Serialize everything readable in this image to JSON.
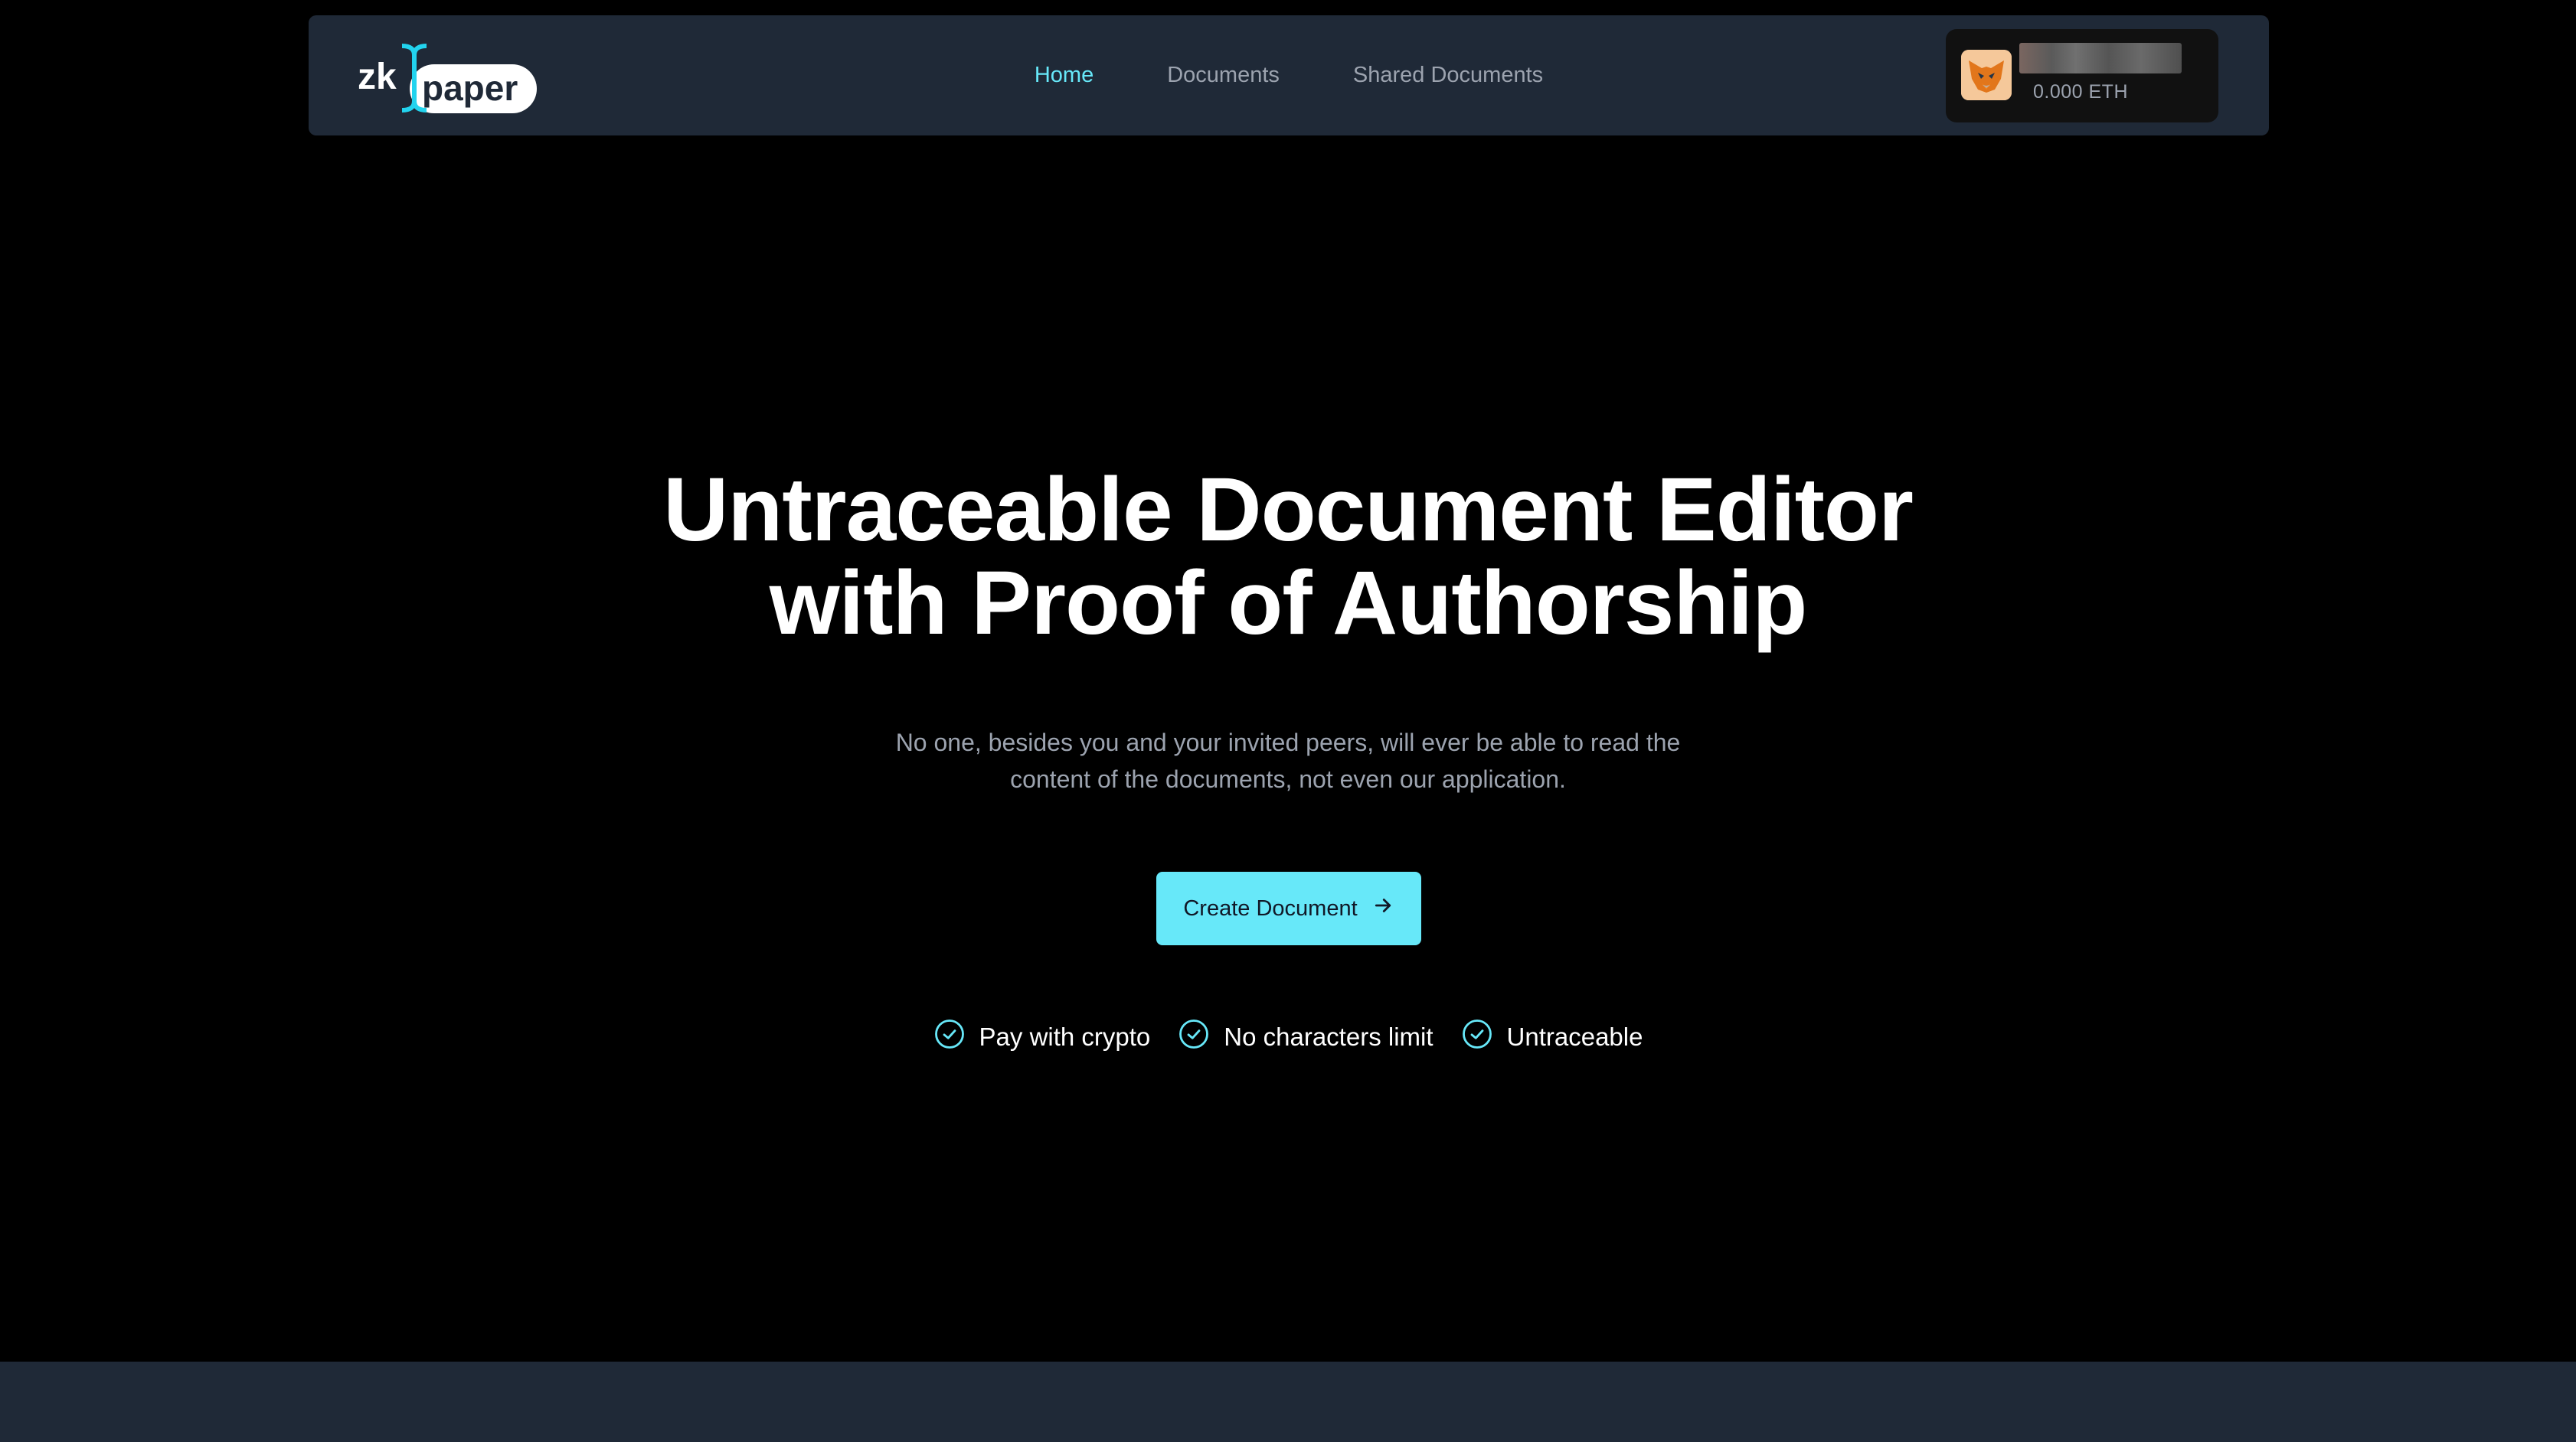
{
  "brand": {
    "logo_left": "zk",
    "logo_right": "paper"
  },
  "nav": {
    "items": [
      {
        "label": "Home",
        "active": true
      },
      {
        "label": "Documents",
        "active": false
      },
      {
        "label": "Shared Documents",
        "active": false
      }
    ]
  },
  "wallet": {
    "avatar_icon": "metamask-fox-icon",
    "balance": "0.000 ETH"
  },
  "hero": {
    "title_line1": "Untraceable Document Editor",
    "title_line2": "with Proof of Authorship",
    "subtitle_line1": "No one, besides you and your invited peers, will ever be able to read the",
    "subtitle_line2": "content of the documents, not even our application.",
    "cta_label": "Create Document",
    "cta_icon": "arrow-right-icon"
  },
  "features": [
    {
      "label": "Pay with crypto",
      "icon": "check-circle-icon"
    },
    {
      "label": "No characters limit",
      "icon": "check-circle-icon"
    },
    {
      "label": "Untraceable",
      "icon": "check-circle-icon"
    }
  ],
  "colors": {
    "background": "#000000",
    "navbar": "#1f2937",
    "accent": "#67e8f9",
    "muted_text": "#9ca3af",
    "footer": "#1f2937"
  }
}
